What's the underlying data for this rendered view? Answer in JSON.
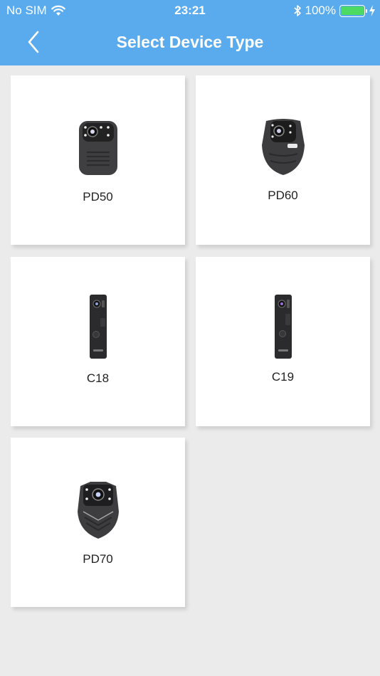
{
  "status_bar": {
    "carrier": "No SIM",
    "time": "23:21",
    "battery_percent": "100%",
    "battery_level": 1.0
  },
  "nav": {
    "title": "Select Device Type",
    "back_icon": "chevron-left-icon"
  },
  "devices": [
    {
      "label": "PD50",
      "icon": "body-camera-pd50-image"
    },
    {
      "label": "PD60",
      "icon": "body-camera-pd60-image"
    },
    {
      "label": "C18",
      "icon": "pen-camera-c18-image"
    },
    {
      "label": "C19",
      "icon": "pen-camera-c19-image"
    },
    {
      "label": "PD70",
      "icon": "body-camera-pd70-image"
    }
  ],
  "colors": {
    "header": "#5aabee",
    "background": "#ebebeb",
    "card": "#ffffff",
    "battery": "#4cd964"
  }
}
